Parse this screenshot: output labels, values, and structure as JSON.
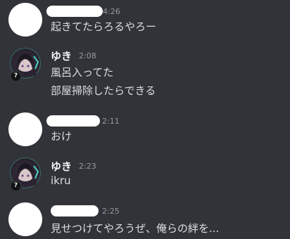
{
  "messages": [
    {
      "author": "",
      "avatar": "blank-avatar",
      "time": "4:26",
      "lines": [
        "起きてたらろるやろー"
      ]
    },
    {
      "author": "ゆき",
      "avatar": "anime-character-avatar",
      "time": "2:08",
      "lines": [
        "風呂入ってた",
        "部屋掃除したらできる"
      ]
    },
    {
      "author": "",
      "avatar": "blank-avatar",
      "time": "2:11",
      "lines": [
        "おけ"
      ]
    },
    {
      "author": "ゆき",
      "avatar": "anime-character-avatar",
      "time": "2:23",
      "lines": [
        "ikru"
      ]
    },
    {
      "author": "",
      "avatar": "blank-avatar",
      "time": "2:25",
      "lines": [
        "見せつけてやろうぜ、俺らの絆を..."
      ]
    }
  ],
  "colors": {
    "background": "#313338",
    "text": "#dbdee1",
    "timestamp": "#949ba4",
    "username": "#f2f3f5"
  }
}
